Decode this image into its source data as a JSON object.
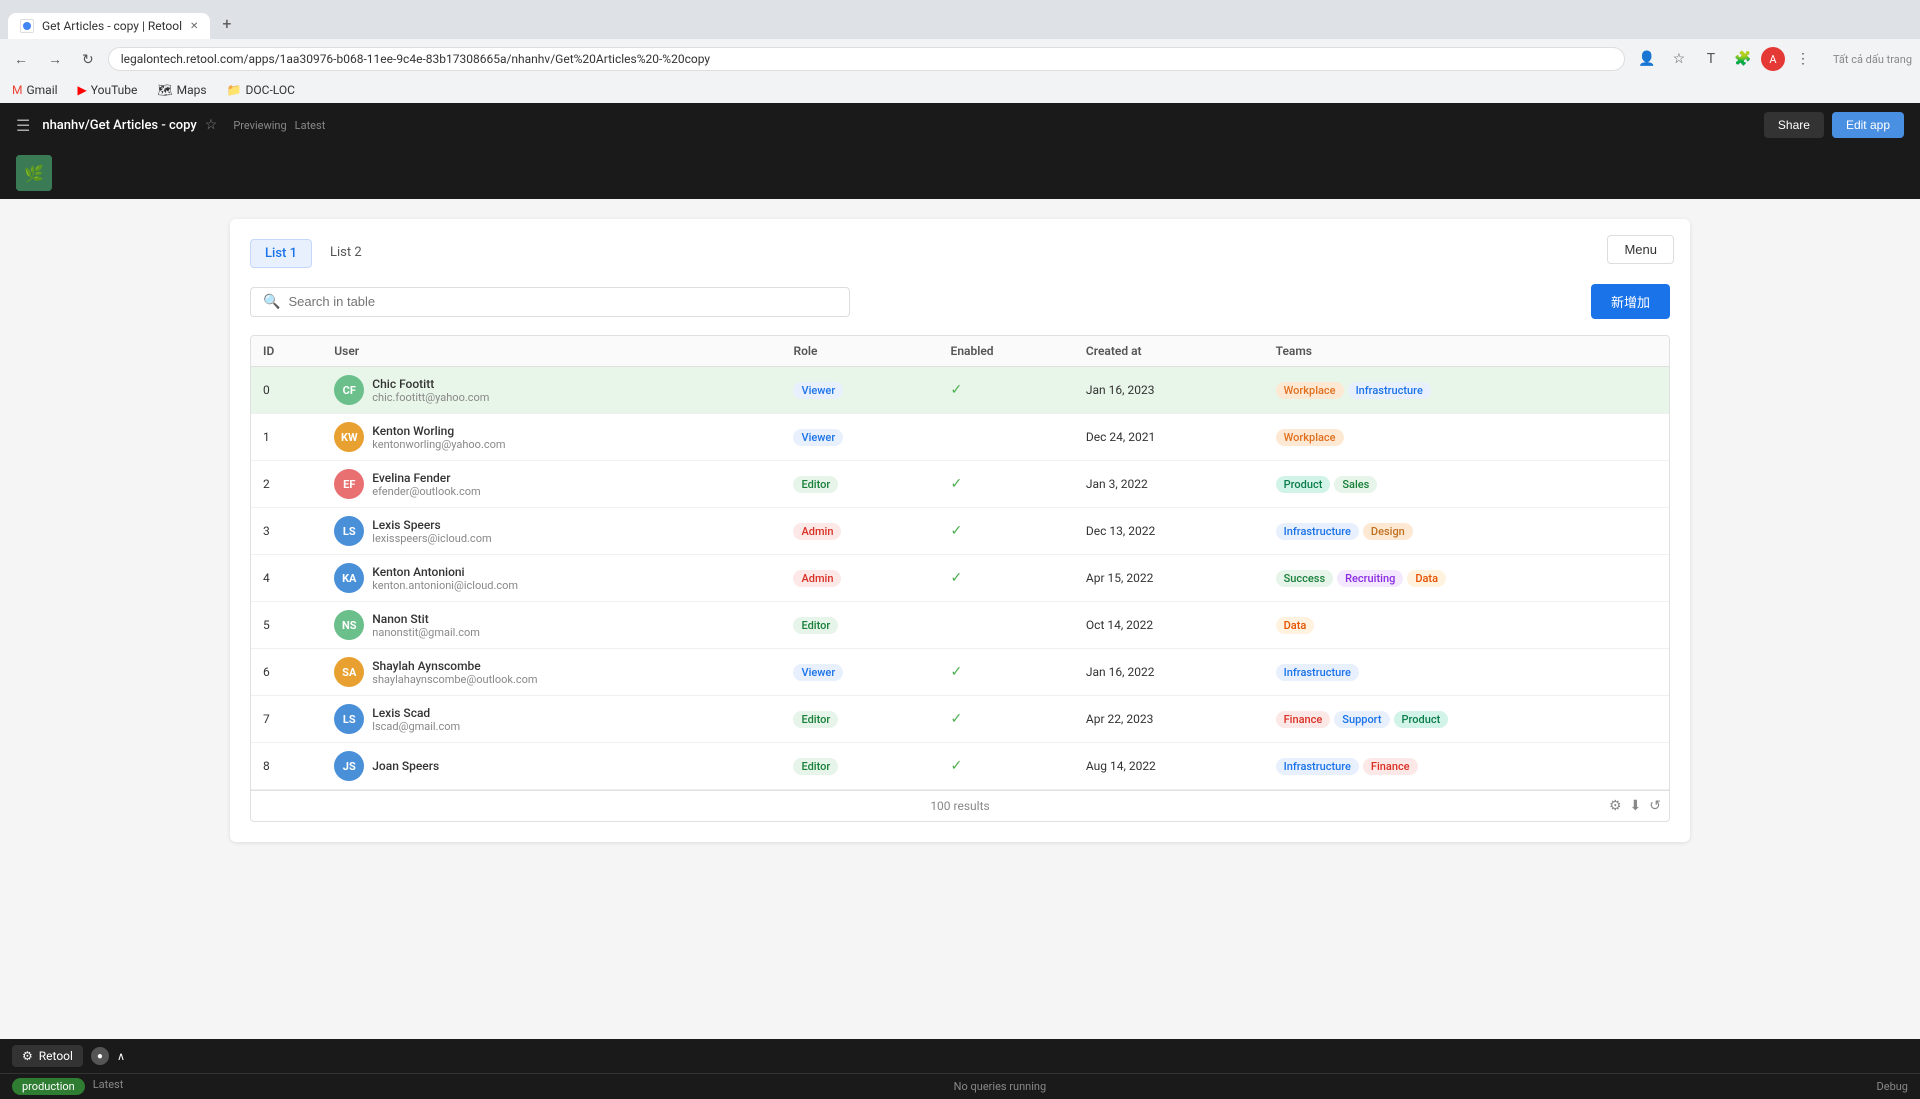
{
  "browser": {
    "tab_title": "Get Articles - copy | Retool",
    "url": "legalontech.retool.com/apps/1aa30976-b068-11ee-9c4e-83b17308665a/nhanhv/Get%20Articles%20-%20copy",
    "new_tab_icon": "+",
    "nav_back": "←",
    "nav_forward": "→",
    "nav_refresh": "↻",
    "bookmarks": [
      {
        "label": "Gmail",
        "icon": "M"
      },
      {
        "label": "YouTube",
        "icon": "▶"
      },
      {
        "label": "Maps",
        "icon": "📍"
      },
      {
        "label": "DOC-LOC",
        "icon": "📁"
      }
    ],
    "toolbar_right_icon": "Tất cả dấu trang"
  },
  "app_bar": {
    "title": "nhanhv/Get Articles - copy",
    "star_icon": "☆",
    "previewing": "Previewing",
    "latest": "Latest",
    "share_label": "Share",
    "edit_app_label": "Edit app"
  },
  "menu_button": "Menu",
  "tabs": [
    {
      "label": "List 1",
      "active": true
    },
    {
      "label": "List 2",
      "active": false
    }
  ],
  "search": {
    "placeholder": "Search in table",
    "value": ""
  },
  "add_button": "新增加",
  "table": {
    "columns": [
      "ID",
      "User",
      "Role",
      "Enabled",
      "Created at",
      "Teams"
    ],
    "rows": [
      {
        "id": 0,
        "avatar_initials": "CF",
        "avatar_color": "#6abf8a",
        "name": "Chic Footitt",
        "email": "chic.footitt@yahoo.com",
        "role": "Viewer",
        "role_class": "tag-role-viewer",
        "enabled": true,
        "created_at": "Jan 16, 2023",
        "teams": [
          {
            "label": "Workplace",
            "class": "tag-workplace"
          },
          {
            "label": "Infrastructure",
            "class": "tag-infrastructure"
          }
        ],
        "selected": true
      },
      {
        "id": 1,
        "avatar_initials": "KW",
        "avatar_color": "#e8a030",
        "name": "Kenton Worling",
        "email": "kentonworling@yahoo.com",
        "role": "Viewer",
        "role_class": "tag-role-viewer",
        "enabled": false,
        "created_at": "Dec 24, 2021",
        "teams": [
          {
            "label": "Workplace",
            "class": "tag-workplace"
          }
        ],
        "selected": false
      },
      {
        "id": 2,
        "avatar_initials": "EF",
        "avatar_color": "#e87070",
        "name": "Evelina Fender",
        "email": "efender@outlook.com",
        "role": "Editor",
        "role_class": "tag-role-editor",
        "enabled": true,
        "created_at": "Jan 3, 2022",
        "teams": [
          {
            "label": "Product",
            "class": "tag-product"
          },
          {
            "label": "Sales",
            "class": "tag-sales"
          }
        ],
        "selected": false
      },
      {
        "id": 3,
        "avatar_initials": "LS",
        "avatar_color": "#4a90d9",
        "name": "Lexis Speers",
        "email": "lexisspeers@icloud.com",
        "role": "Admin",
        "role_class": "tag-role-admin",
        "enabled": true,
        "created_at": "Dec 13, 2022",
        "teams": [
          {
            "label": "Infrastructure",
            "class": "tag-infrastructure"
          },
          {
            "label": "Design",
            "class": "tag-design"
          }
        ],
        "selected": false
      },
      {
        "id": 4,
        "avatar_initials": "KA",
        "avatar_color": "#4a90d9",
        "name": "Kenton Antonioni",
        "email": "kenton.antonioni@icloud.com",
        "role": "Admin",
        "role_class": "tag-role-admin",
        "enabled": true,
        "created_at": "Apr 15, 2022",
        "teams": [
          {
            "label": "Success",
            "class": "tag-success"
          },
          {
            "label": "Recruiting",
            "class": "tag-recruiting"
          },
          {
            "label": "Data",
            "class": "tag-data"
          }
        ],
        "selected": false
      },
      {
        "id": 5,
        "avatar_initials": "NS",
        "avatar_color": "#6abf8a",
        "name": "Nanon Stit",
        "email": "nanonstit@gmail.com",
        "role": "Editor",
        "role_class": "tag-role-editor",
        "enabled": false,
        "created_at": "Oct 14, 2022",
        "teams": [
          {
            "label": "Data",
            "class": "tag-data"
          }
        ],
        "selected": false
      },
      {
        "id": 6,
        "avatar_initials": "SA",
        "avatar_color": "#e8a030",
        "name": "Shaylah Aynscombe",
        "email": "shaylahaynscombe@outlook.com",
        "role": "Viewer",
        "role_class": "tag-role-viewer",
        "enabled": true,
        "created_at": "Jan 16, 2022",
        "teams": [
          {
            "label": "Infrastructure",
            "class": "tag-infrastructure"
          }
        ],
        "selected": false
      },
      {
        "id": 7,
        "avatar_initials": "LS",
        "avatar_color": "#4a90d9",
        "name": "Lexis Scad",
        "email": "lscad@gmail.com",
        "role": "Editor",
        "role_class": "tag-role-editor",
        "enabled": true,
        "created_at": "Apr 22, 2023",
        "teams": [
          {
            "label": "Finance",
            "class": "tag-finance"
          },
          {
            "label": "Support",
            "class": "tag-support"
          },
          {
            "label": "Product",
            "class": "tag-product"
          }
        ],
        "selected": false
      },
      {
        "id": 8,
        "avatar_initials": "JS",
        "avatar_color": "#4a90d9",
        "name": "Joan Speers",
        "email": "",
        "role": "Editor",
        "role_class": "tag-role-editor",
        "enabled": true,
        "created_at": "Aug 14, 2022",
        "teams": [
          {
            "label": "Infrastructure",
            "class": "tag-infrastructure"
          },
          {
            "label": "Finance",
            "class": "tag-finance"
          }
        ],
        "selected": false
      }
    ],
    "results_count": "100 results"
  },
  "bottom": {
    "retool_label": "Retool",
    "env_label": "production",
    "latest_label": "Latest",
    "status": "No queries running",
    "debug_label": "Debug"
  }
}
